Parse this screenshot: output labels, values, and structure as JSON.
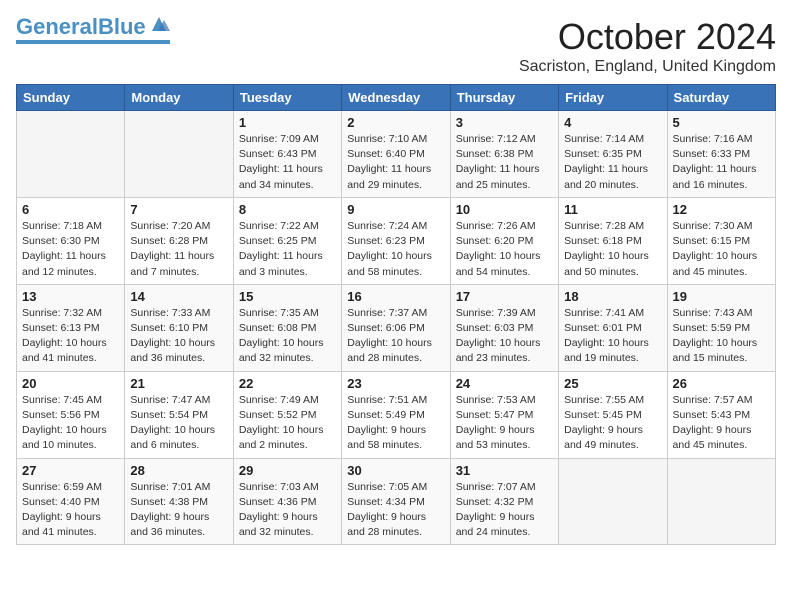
{
  "logo": {
    "part1": "General",
    "part2": "Blue"
  },
  "header": {
    "month": "October 2024",
    "location": "Sacriston, England, United Kingdom"
  },
  "days_of_week": [
    "Sunday",
    "Monday",
    "Tuesday",
    "Wednesday",
    "Thursday",
    "Friday",
    "Saturday"
  ],
  "weeks": [
    [
      {
        "day": "",
        "info": ""
      },
      {
        "day": "",
        "info": ""
      },
      {
        "day": "1",
        "info": "Sunrise: 7:09 AM\nSunset: 6:43 PM\nDaylight: 11 hours and 34 minutes."
      },
      {
        "day": "2",
        "info": "Sunrise: 7:10 AM\nSunset: 6:40 PM\nDaylight: 11 hours and 29 minutes."
      },
      {
        "day": "3",
        "info": "Sunrise: 7:12 AM\nSunset: 6:38 PM\nDaylight: 11 hours and 25 minutes."
      },
      {
        "day": "4",
        "info": "Sunrise: 7:14 AM\nSunset: 6:35 PM\nDaylight: 11 hours and 20 minutes."
      },
      {
        "day": "5",
        "info": "Sunrise: 7:16 AM\nSunset: 6:33 PM\nDaylight: 11 hours and 16 minutes."
      }
    ],
    [
      {
        "day": "6",
        "info": "Sunrise: 7:18 AM\nSunset: 6:30 PM\nDaylight: 11 hours and 12 minutes."
      },
      {
        "day": "7",
        "info": "Sunrise: 7:20 AM\nSunset: 6:28 PM\nDaylight: 11 hours and 7 minutes."
      },
      {
        "day": "8",
        "info": "Sunrise: 7:22 AM\nSunset: 6:25 PM\nDaylight: 11 hours and 3 minutes."
      },
      {
        "day": "9",
        "info": "Sunrise: 7:24 AM\nSunset: 6:23 PM\nDaylight: 10 hours and 58 minutes."
      },
      {
        "day": "10",
        "info": "Sunrise: 7:26 AM\nSunset: 6:20 PM\nDaylight: 10 hours and 54 minutes."
      },
      {
        "day": "11",
        "info": "Sunrise: 7:28 AM\nSunset: 6:18 PM\nDaylight: 10 hours and 50 minutes."
      },
      {
        "day": "12",
        "info": "Sunrise: 7:30 AM\nSunset: 6:15 PM\nDaylight: 10 hours and 45 minutes."
      }
    ],
    [
      {
        "day": "13",
        "info": "Sunrise: 7:32 AM\nSunset: 6:13 PM\nDaylight: 10 hours and 41 minutes."
      },
      {
        "day": "14",
        "info": "Sunrise: 7:33 AM\nSunset: 6:10 PM\nDaylight: 10 hours and 36 minutes."
      },
      {
        "day": "15",
        "info": "Sunrise: 7:35 AM\nSunset: 6:08 PM\nDaylight: 10 hours and 32 minutes."
      },
      {
        "day": "16",
        "info": "Sunrise: 7:37 AM\nSunset: 6:06 PM\nDaylight: 10 hours and 28 minutes."
      },
      {
        "day": "17",
        "info": "Sunrise: 7:39 AM\nSunset: 6:03 PM\nDaylight: 10 hours and 23 minutes."
      },
      {
        "day": "18",
        "info": "Sunrise: 7:41 AM\nSunset: 6:01 PM\nDaylight: 10 hours and 19 minutes."
      },
      {
        "day": "19",
        "info": "Sunrise: 7:43 AM\nSunset: 5:59 PM\nDaylight: 10 hours and 15 minutes."
      }
    ],
    [
      {
        "day": "20",
        "info": "Sunrise: 7:45 AM\nSunset: 5:56 PM\nDaylight: 10 hours and 10 minutes."
      },
      {
        "day": "21",
        "info": "Sunrise: 7:47 AM\nSunset: 5:54 PM\nDaylight: 10 hours and 6 minutes."
      },
      {
        "day": "22",
        "info": "Sunrise: 7:49 AM\nSunset: 5:52 PM\nDaylight: 10 hours and 2 minutes."
      },
      {
        "day": "23",
        "info": "Sunrise: 7:51 AM\nSunset: 5:49 PM\nDaylight: 9 hours and 58 minutes."
      },
      {
        "day": "24",
        "info": "Sunrise: 7:53 AM\nSunset: 5:47 PM\nDaylight: 9 hours and 53 minutes."
      },
      {
        "day": "25",
        "info": "Sunrise: 7:55 AM\nSunset: 5:45 PM\nDaylight: 9 hours and 49 minutes."
      },
      {
        "day": "26",
        "info": "Sunrise: 7:57 AM\nSunset: 5:43 PM\nDaylight: 9 hours and 45 minutes."
      }
    ],
    [
      {
        "day": "27",
        "info": "Sunrise: 6:59 AM\nSunset: 4:40 PM\nDaylight: 9 hours and 41 minutes."
      },
      {
        "day": "28",
        "info": "Sunrise: 7:01 AM\nSunset: 4:38 PM\nDaylight: 9 hours and 36 minutes."
      },
      {
        "day": "29",
        "info": "Sunrise: 7:03 AM\nSunset: 4:36 PM\nDaylight: 9 hours and 32 minutes."
      },
      {
        "day": "30",
        "info": "Sunrise: 7:05 AM\nSunset: 4:34 PM\nDaylight: 9 hours and 28 minutes."
      },
      {
        "day": "31",
        "info": "Sunrise: 7:07 AM\nSunset: 4:32 PM\nDaylight: 9 hours and 24 minutes."
      },
      {
        "day": "",
        "info": ""
      },
      {
        "day": "",
        "info": ""
      }
    ]
  ]
}
